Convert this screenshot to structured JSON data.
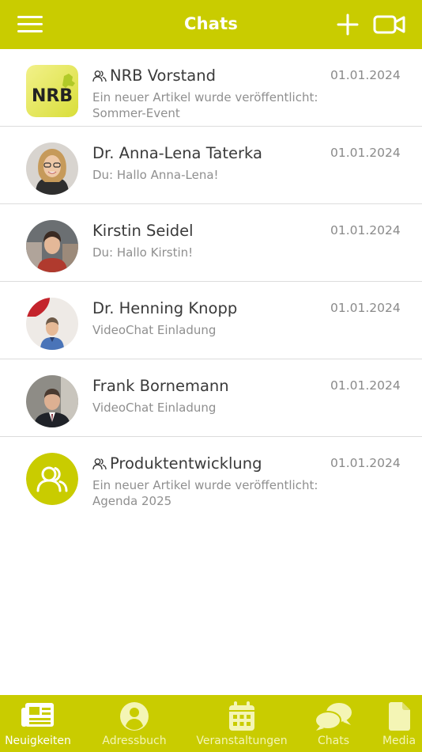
{
  "header": {
    "title": "Chats"
  },
  "chats": [
    {
      "name": "NRB Vorstand",
      "is_group": true,
      "date": "01.01.2024",
      "preview": "Ein neuer Artikel wurde veröffentlicht: Sommer-Event",
      "avatar_text": "NRB"
    },
    {
      "name": "Dr. Anna-Lena Taterka",
      "is_group": false,
      "date": "01.01.2024",
      "preview": "Du: Hallo Anna-Lena!"
    },
    {
      "name": "Kirstin Seidel",
      "is_group": false,
      "date": "01.01.2024",
      "preview": "Du: Hallo Kirstin!"
    },
    {
      "name": "Dr. Henning Knopp",
      "is_group": false,
      "date": "01.01.2024",
      "preview": "VideoChat Einladung"
    },
    {
      "name": "Frank Bornemann",
      "is_group": false,
      "date": "01.01.2024",
      "preview": "VideoChat Einladung"
    },
    {
      "name": "Produktentwicklung",
      "is_group": true,
      "date": "01.01.2024",
      "preview": "Ein neuer Artikel wurde veröffentlicht: Agenda 2025"
    }
  ],
  "tabs": [
    {
      "label": "Neuigkeiten",
      "icon": "newspaper-icon",
      "active": true
    },
    {
      "label": "Adressbuch",
      "icon": "user-circle-icon",
      "active": false
    },
    {
      "label": "Veranstaltungen",
      "icon": "calendar-icon",
      "active": false
    },
    {
      "label": "Chats",
      "icon": "chat-bubbles-icon",
      "active": false
    },
    {
      "label": "Media",
      "icon": "document-icon",
      "active": false
    }
  ],
  "colors": {
    "brand": "#c9cc00",
    "text_dark": "#3a3a3a",
    "text_muted": "#8f8f8f",
    "divider": "#dcdcdc"
  }
}
